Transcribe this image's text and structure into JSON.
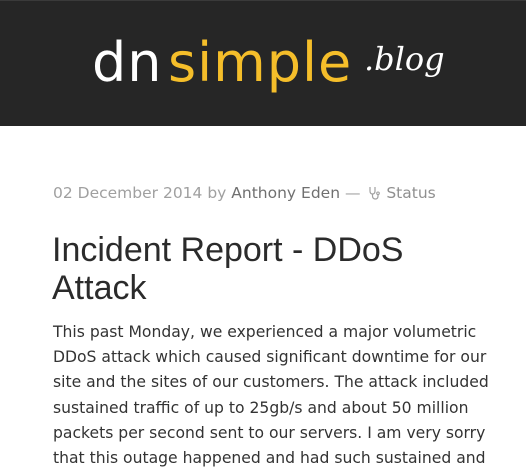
{
  "header": {
    "logo_dn": "dn",
    "logo_simple": "simple",
    "logo_blog": ".blog"
  },
  "post": {
    "date": "02 December 2014",
    "by": "by",
    "author": "Anthony Eden",
    "separator": "—",
    "category": "Status",
    "category_icon": "stethoscope-icon",
    "title_lines": [
      "Incident Report - DDoS",
      "Attack"
    ],
    "body_lines": [
      "This past Monday, we experienced a major volumetric",
      "DDoS attack which caused significant downtime for our",
      "site and the sites of our customers. The attack included",
      "sustained traffic of up to 25gb/s and about 50 million",
      "packets per second sent to our servers. I am very sorry",
      "that this outage happened and had such sustained and"
    ]
  },
  "colors": {
    "header_bg": "#262626",
    "logo_accent": "#f5be2a",
    "meta_text": "#a0a0a0",
    "title_text": "#2b2b2b",
    "body_text": "#333333"
  }
}
